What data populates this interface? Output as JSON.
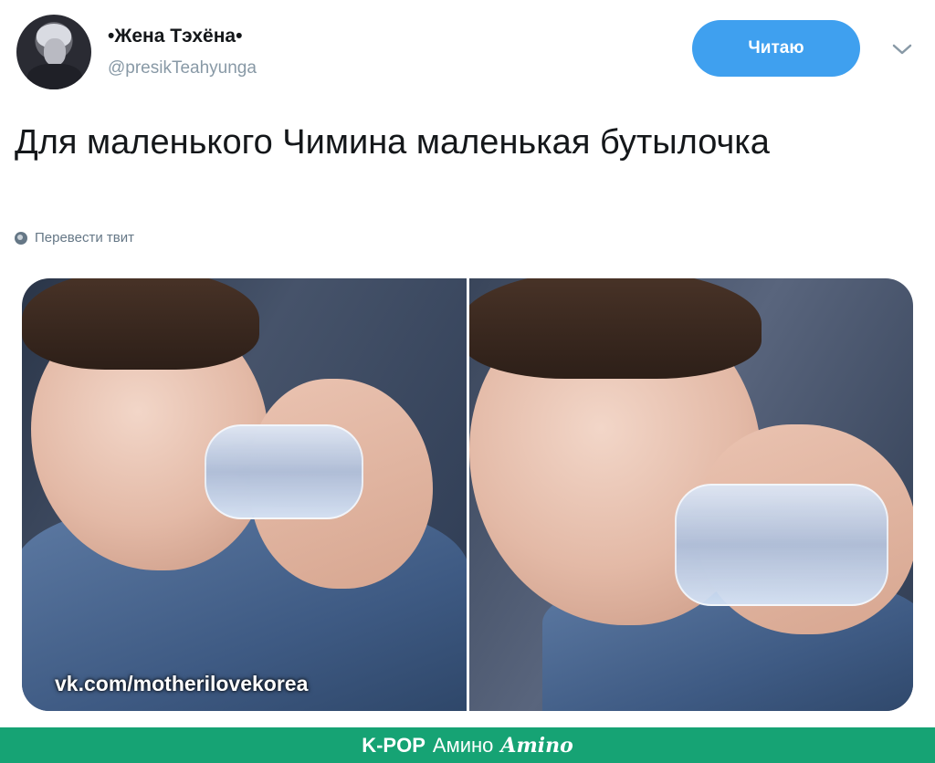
{
  "tweet": {
    "author_name": "•Жена Тэхёна•",
    "author_handle": "@presikTeahyunga",
    "follow_label": "Читаю",
    "text": "Для маленького Чимина маленькая бутылочка",
    "translate_label": "Перевести твит"
  },
  "media": {
    "watermark": "vk.com/motherilovekorea"
  },
  "footer": {
    "brand": "K-POP",
    "community": "Амино",
    "logo_text": "Amino"
  },
  "icons": {
    "chevron": "chevron-down-icon",
    "globe": "globe-icon"
  },
  "colors": {
    "follow_button": "#3fa0ef",
    "footer_background": "#16a374",
    "handle_text": "#8899a6"
  }
}
